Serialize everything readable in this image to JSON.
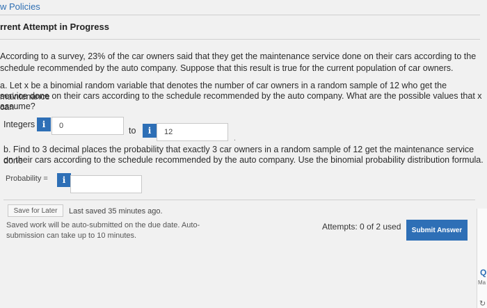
{
  "nav": {
    "policies_link": "w Policies"
  },
  "header": {
    "title": "rrent Attempt in Progress"
  },
  "problem": {
    "intro_line1": "According to a survey, 23% of the car owners said that they get the maintenance service done on their cars according to the",
    "intro_line2": "schedule recommended by the auto company. Suppose that this result is true for the current population of car owners.",
    "part_a_line1": "a. Let x be a binomial random variable that denotes the number of car owners in a random sample of 12 who get the maintenance",
    "part_a_line2": "service done on their cars according to the schedule recommended by the auto company. What are the possible values that x can",
    "part_a_line3": "assume?",
    "integers_label": "Integers",
    "lower_value": "0",
    "to_label": "to",
    "upper_value": "12",
    "part_b_line1": "b. Find to 3 decimal places the probability that exactly 3 car owners in a random sample of 12 get the maintenance service done",
    "part_b_line2": "on their cars according to the schedule recommended by the auto company. Use the binomial probability distribution formula.",
    "probability_label": "Probability =",
    "probability_value": ""
  },
  "footer": {
    "save_later": "Save for Later",
    "last_saved": "Last saved 35 minutes ago.",
    "auto_submit_line1": "Saved work will be auto-submitted on the due date. Auto-",
    "auto_submit_line2": "submission can take up to 10 minutes.",
    "attempts": "Attempts: 0 of 2 used",
    "submit": "Submit Answer"
  },
  "side": {
    "partial_q": "Q",
    "partial_ma": "Ma",
    "partial_bottom": "↻"
  },
  "colors": {
    "accent": "#2e6fb6",
    "background": "#f1f1f1"
  }
}
